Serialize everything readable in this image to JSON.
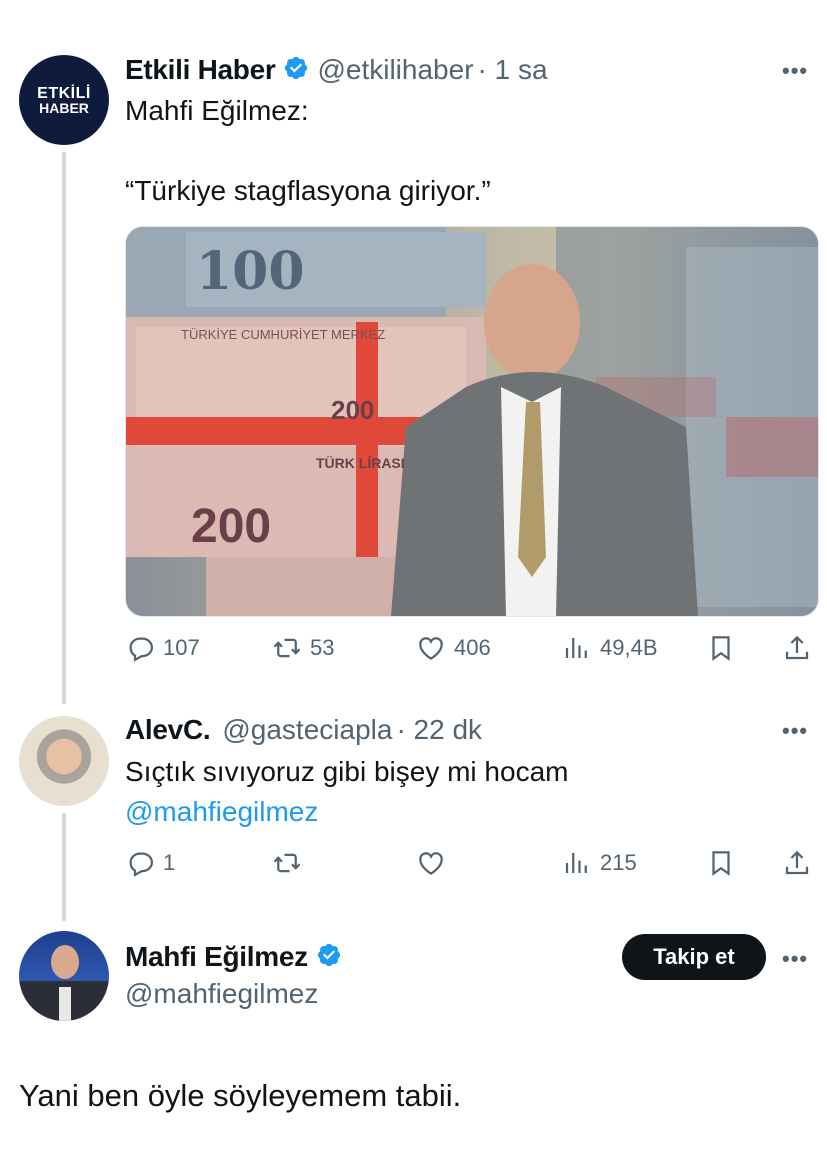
{
  "tweet1": {
    "avatar_text_line1": "ETKİLİ",
    "avatar_text_line2": "HABER",
    "name": "Etkili Haber",
    "handle": "@etkilihaber",
    "time": "· 1 sa",
    "text_line1": "Mahfi Eğilmez:",
    "text_line2": "“Türkiye stagflasyona giriyor.”",
    "image_banknote_text1": "100",
    "image_banknote_text2": "TÜRKİYE CUMHURİYET MERKEZ",
    "image_banknote_text3": "200",
    "image_banknote_text4": "TÜRK LİRASI",
    "replies": "107",
    "retweets": "53",
    "likes": "406",
    "views": "49,4B"
  },
  "tweet2": {
    "name": "AlevC.",
    "handle": "@gasteciapla",
    "time": "· 22 dk",
    "text": "Sıçtık sıvıyoruz gibi bişey mi hocam",
    "mention": "@mahfiegilmez",
    "replies": "1",
    "retweets": "",
    "likes": "",
    "views": "215"
  },
  "tweet3": {
    "name": "Mahfi Eğilmez",
    "handle": "@mahfiegilmez",
    "follow_label": "Takip et",
    "text": "Yani ben öyle söyleyemem tabii."
  },
  "colors": {
    "accent": "#1d9bf0",
    "muted": "#536471",
    "line": "#cfd9de",
    "avatar_bg": "#0f1b3d"
  },
  "icons": [
    "verified-icon",
    "more-icon",
    "reply-icon",
    "retweet-icon",
    "like-icon",
    "views-icon",
    "bookmark-icon",
    "share-icon"
  ]
}
